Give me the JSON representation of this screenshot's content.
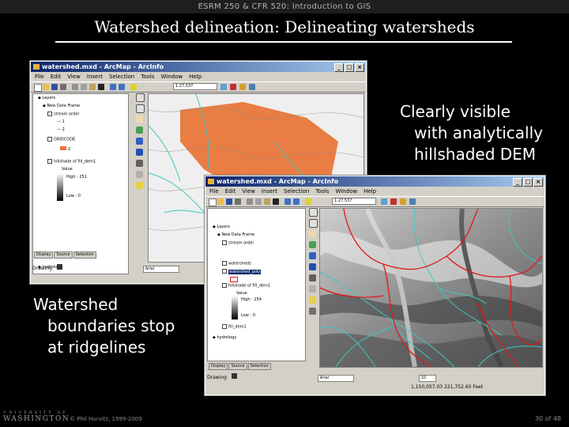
{
  "header": {
    "course": "ESRM 250 & CFR 520: Introduction to GIS"
  },
  "slide": {
    "title": "Watershed delineation: Delineating watersheds"
  },
  "callouts": {
    "right": [
      "Clearly visible",
      "with analytically",
      "hillshaded DEM"
    ],
    "left": [
      "Watershed",
      "boundaries stop",
      "at ridgelines"
    ]
  },
  "window_back": {
    "title": "watershed.mxd - ArcMap - ArcInfo",
    "menu": [
      "File",
      "Edit",
      "View",
      "Insert",
      "Selection",
      "Tools",
      "Window",
      "Help"
    ],
    "scale_value": "1:27,537",
    "toc": {
      "rows": [
        "Layers",
        "New Data Frame",
        "stream order",
        "1",
        "2",
        "GRIDCODE",
        "2",
        "hillshade of fill_dem1",
        "Value",
        "High : 251",
        "Low : 0",
        "hydrology"
      ]
    },
    "tabs": [
      "Display",
      "Source",
      "Selection"
    ],
    "drawing_label": "Drawing",
    "font_name": "Arial"
  },
  "window_front": {
    "title": "watershed.mxd - ArcMap - ArcInfo",
    "menu": [
      "File",
      "Edit",
      "View",
      "Insert",
      "Selection",
      "Tools",
      "Window",
      "Help"
    ],
    "scale_value": "1:27,537",
    "toc": {
      "rows": [
        "Layers",
        "New Data Frame",
        "stream order",
        "watersheds",
        "watershed_poly",
        "hillshade of fill_dem1",
        "Value",
        "High : 254",
        "Low : 0",
        "fill_dem1",
        "hydrology"
      ]
    },
    "tabs": [
      "Display",
      "Source",
      "Selection"
    ],
    "drawing_label": "Drawing",
    "font_name": "Arial",
    "font_size": "10",
    "coords": "1,150,057.03  221,752.60 Feet"
  },
  "footer": {
    "university_small": "UNIVERSITY OF",
    "university_big": "WASHINGTON",
    "copyright": "© Phil Hurvitz, 1999-2009",
    "page": "30 of 48"
  },
  "colors": {
    "watershed_fill": "#e8763a",
    "stream": "#3fc7c0",
    "boundary": "#e01818",
    "win_face": "#d4d0c8"
  }
}
